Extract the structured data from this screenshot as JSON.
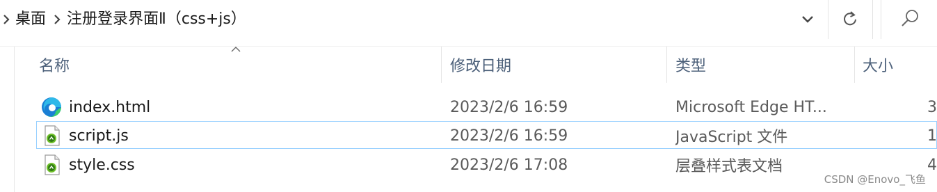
{
  "address_bar": {
    "crumbs": [
      "桌面",
      "注册登录界面Ⅱ（css+js）"
    ]
  },
  "columns": {
    "name": "名称",
    "date_modified": "修改日期",
    "type": "类型",
    "size": "大小"
  },
  "files": [
    {
      "name": "index.html",
      "date_modified": "2023/2/6 16:59",
      "type": "Microsoft Edge HT...",
      "size": "3",
      "icon": "edge-html-file-icon"
    },
    {
      "name": "script.js",
      "date_modified": "2023/2/6 16:59",
      "type": "JavaScript 文件",
      "size": "1",
      "icon": "script-file-icon"
    },
    {
      "name": "style.css",
      "date_modified": "2023/2/6 17:08",
      "type": "层叠样式表文档",
      "size": "4",
      "icon": "script-file-icon"
    }
  ],
  "watermark": "CSDN @Enovo_飞鱼",
  "colors": {
    "focus_border": "#99d1ff",
    "header_text": "#4c607a",
    "detail_text": "#5a5a5a"
  }
}
